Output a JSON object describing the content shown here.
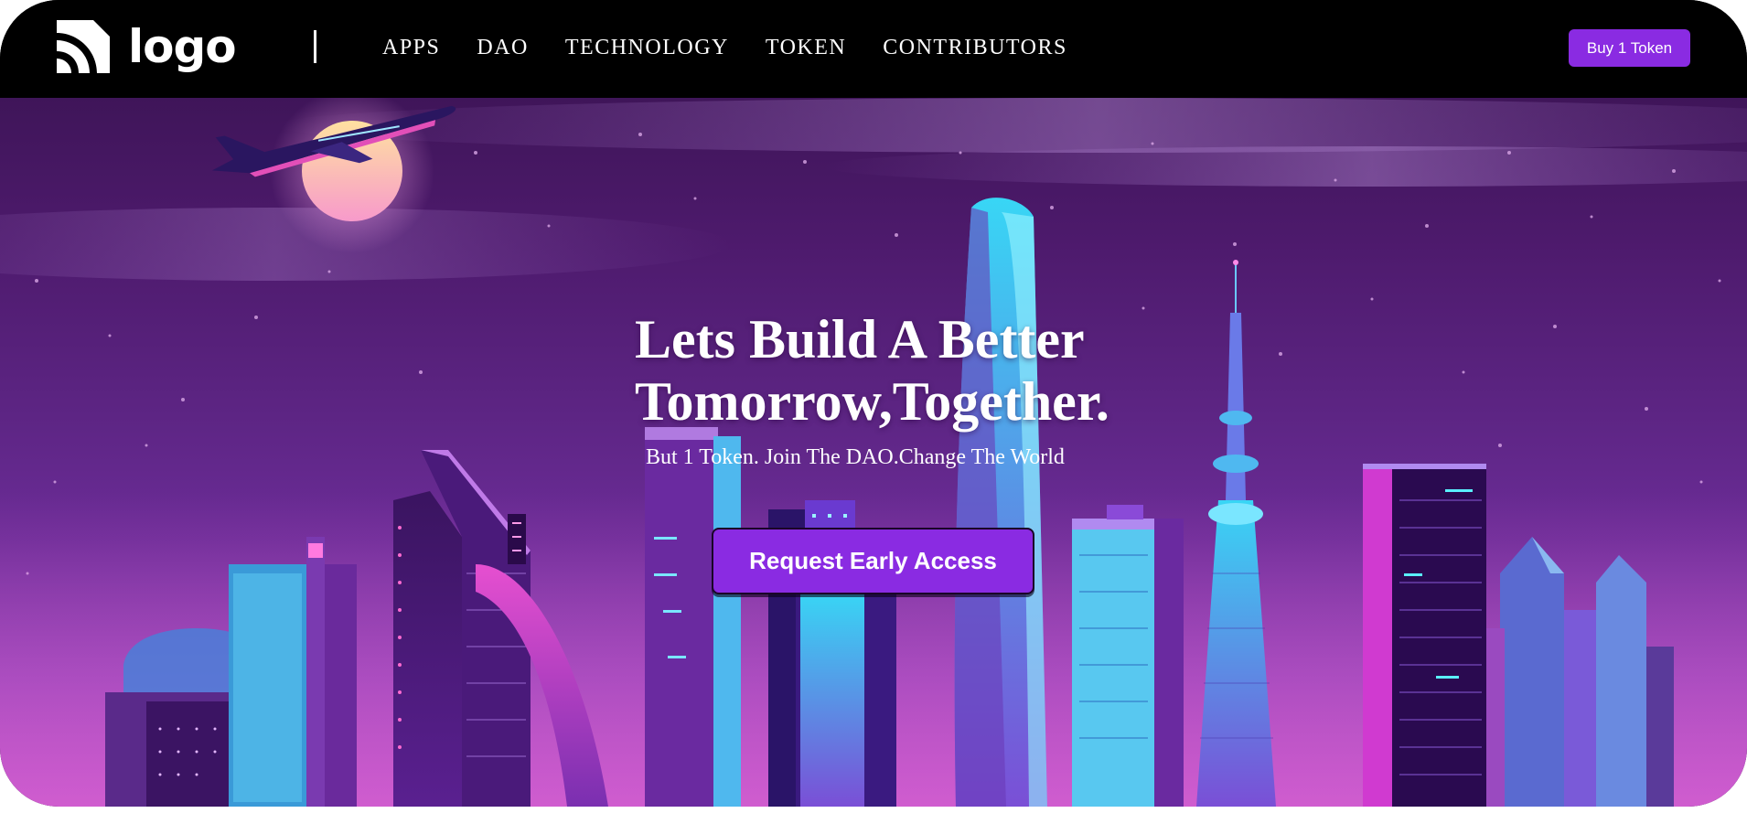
{
  "nav": {
    "logo_text": "logo",
    "links": [
      "APPS",
      "DAO",
      "TECHNOLOGY",
      "TOKEN",
      "CONTRIBUTORS"
    ],
    "buy_button": "Buy 1 Token"
  },
  "hero": {
    "title_line1": "Lets Build A Better",
    "title_line2": "Tomorrow,Together.",
    "subtitle": "But 1 Token. Join The DAO.Change The World",
    "cta": "Request Early Access"
  },
  "colors": {
    "accent": "#8a2be2",
    "nav_bg": "#000000",
    "text": "#ffffff"
  },
  "icons": [
    "logo-signal-icon"
  ]
}
